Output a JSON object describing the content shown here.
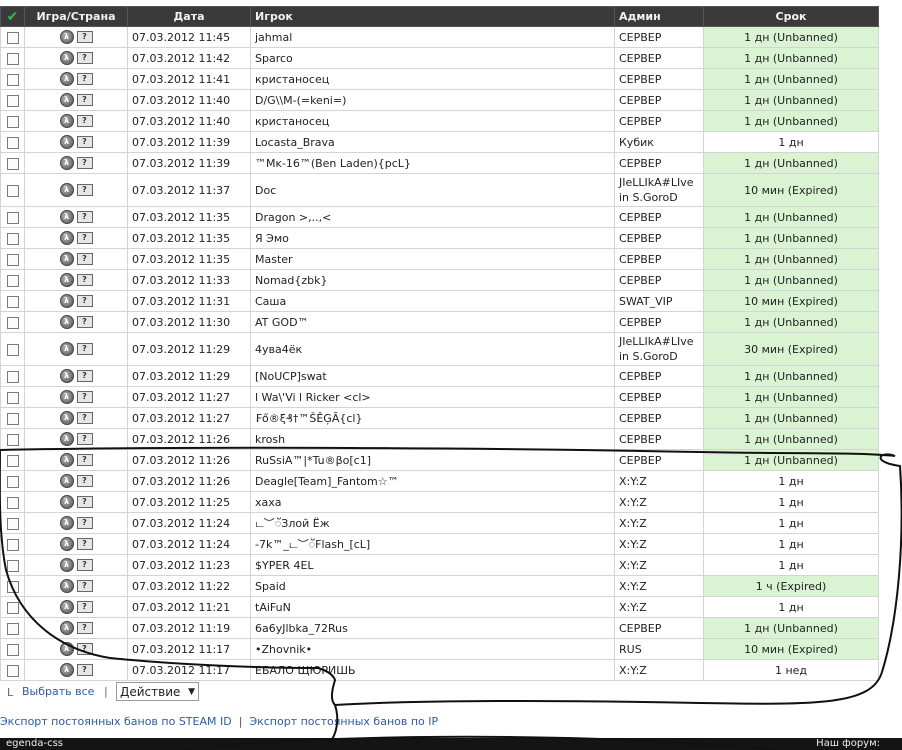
{
  "table": {
    "headers": {
      "check": "✔",
      "game": "Игра/Страна",
      "date": "Дата",
      "player": "Игрок",
      "admin": "Админ",
      "duration": "Срок"
    },
    "rows": [
      {
        "date": "07.03.2012 11:45",
        "player": "jahmal",
        "admin": [
          "СЕРВЕР"
        ],
        "duration": "1 дн (Unbanned)",
        "active": true
      },
      {
        "date": "07.03.2012 11:42",
        "player": "Sparco",
        "admin": [
          "СЕРВЕР"
        ],
        "duration": "1 дн (Unbanned)",
        "active": true
      },
      {
        "date": "07.03.2012 11:41",
        "player": "кристаносец",
        "admin": [
          "СЕРВЕР"
        ],
        "duration": "1 дн (Unbanned)",
        "active": true
      },
      {
        "date": "07.03.2012 11:40",
        "player": "D/G\\\\M-(=keni=)",
        "admin": [
          "СЕРВЕР"
        ],
        "duration": "1 дн (Unbanned)",
        "active": true
      },
      {
        "date": "07.03.2012 11:40",
        "player": "кристаносец",
        "admin": [
          "СЕРВЕР"
        ],
        "duration": "1 дн (Unbanned)",
        "active": true
      },
      {
        "date": "07.03.2012 11:39",
        "player": "Locasta_Brava",
        "admin": [
          "Кубик"
        ],
        "duration": "1 дн",
        "active": false
      },
      {
        "date": "07.03.2012 11:39",
        "player": "™Mĸ-16™(Ben Laden){pcL}",
        "admin": [
          "СЕРВЕР"
        ],
        "duration": "1 дн (Unbanned)",
        "active": true
      },
      {
        "date": "07.03.2012 11:37",
        "player": "Doc",
        "admin": [
          "JIeLLIkA#LIve",
          "in S.GoroD"
        ],
        "duration": "10 мин (Expired)",
        "active": true
      },
      {
        "date": "07.03.2012 11:35",
        "player": "Dragon >,..,<",
        "admin": [
          "СЕРВЕР"
        ],
        "duration": "1 дн (Unbanned)",
        "active": true
      },
      {
        "date": "07.03.2012 11:35",
        "player": "Я Эмо",
        "admin": [
          "СЕРВЕР"
        ],
        "duration": "1 дн (Unbanned)",
        "active": true
      },
      {
        "date": "07.03.2012 11:35",
        "player": "Master",
        "admin": [
          "СЕРВЕР"
        ],
        "duration": "1 дн (Unbanned)",
        "active": true
      },
      {
        "date": "07.03.2012 11:33",
        "player": "Nomad{zbk}",
        "admin": [
          "СЕРВЕР"
        ],
        "duration": "1 дн (Unbanned)",
        "active": true
      },
      {
        "date": "07.03.2012 11:31",
        "player": "Саша",
        "admin": [
          "SWAT_VIP"
        ],
        "duration": "10 мин (Expired)",
        "active": true
      },
      {
        "date": "07.03.2012 11:30",
        "player": "AT GOD™",
        "admin": [
          "СЕРВЕР"
        ],
        "duration": "1 дн (Unbanned)",
        "active": true
      },
      {
        "date": "07.03.2012 11:29",
        "player": "4ува4ёк",
        "admin": [
          "JIeLLIkA#LIve",
          "in S.GoroD"
        ],
        "duration": "30 мин (Expired)",
        "active": true
      },
      {
        "date": "07.03.2012 11:29",
        "player": "[NoUCP]swat",
        "admin": [
          "СЕРВЕР"
        ],
        "duration": "1 дн (Unbanned)",
        "active": true
      },
      {
        "date": "07.03.2012 11:27",
        "player": "l Wa\\'Vi l Ricker <cl>",
        "admin": [
          "СЕРВЕР"
        ],
        "duration": "1 дн (Unbanned)",
        "active": true
      },
      {
        "date": "07.03.2012 11:27",
        "player": "₣ő®ξ₰†™ŠĚĢÃ{cl}",
        "admin": [
          "СЕРВЕР"
        ],
        "duration": "1 дн (Unbanned)",
        "active": true
      },
      {
        "date": "07.03.2012 11:26",
        "player": "krosh",
        "admin": [
          "СЕРВЕР"
        ],
        "duration": "1 дн (Unbanned)",
        "active": true
      },
      {
        "date": "07.03.2012 11:26",
        "player": "RuSsiA™|*Tu®βo[c1]",
        "admin": [
          "СЕРВЕР"
        ],
        "duration": "1 дн (Unbanned)",
        "active": true
      },
      {
        "date": "07.03.2012 11:26",
        "player": "Deagle[Team]_Fantom☆™",
        "admin": [
          "X:Y:Z"
        ],
        "duration": "1 дн",
        "active": false
      },
      {
        "date": "07.03.2012 11:25",
        "player": "хаха",
        "admin": [
          "X:Y:Z"
        ],
        "duration": "1 дн",
        "active": false
      },
      {
        "date": "07.03.2012 11:24",
        "player": "ட︶ॅЗлой Ёж",
        "admin": [
          "X:Y:Z"
        ],
        "duration": "1 дн",
        "active": false
      },
      {
        "date": "07.03.2012 11:24",
        "player": "-7k™_ட︶ॅFlash_[cL]",
        "admin": [
          "X:Y:Z"
        ],
        "duration": "1 дн",
        "active": false
      },
      {
        "date": "07.03.2012 11:23",
        "player": "$YPER 4EL",
        "admin": [
          "X:Y:Z"
        ],
        "duration": "1 дн",
        "active": false
      },
      {
        "date": "07.03.2012 11:22",
        "player": "Spaid",
        "admin": [
          "X:Y:Z"
        ],
        "duration": "1 ч (Expired)",
        "active": true
      },
      {
        "date": "07.03.2012 11:21",
        "player": "tAiFuN",
        "admin": [
          "X:Y:Z"
        ],
        "duration": "1 дн",
        "active": false
      },
      {
        "date": "07.03.2012 11:19",
        "player": "6a6yJlbka_72Rus",
        "admin": [
          "СЕРВЕР"
        ],
        "duration": "1 дн (Unbanned)",
        "active": true
      },
      {
        "date": "07.03.2012 11:17",
        "player": "•Zhovnik•",
        "admin": [
          "RUS"
        ],
        "duration": "10 мин (Expired)",
        "active": true
      },
      {
        "date": "07.03.2012 11:17",
        "player": "ЕБАЛО ЩЮРИШЬ",
        "admin": [
          "X:Y:Z"
        ],
        "duration": "1 нед",
        "active": false
      }
    ]
  },
  "footer": {
    "arrow": "L",
    "select_all": "Выбрать все",
    "separator": "|",
    "action_label": "Действие",
    "action_caret": "▼"
  },
  "export": {
    "steam_link": "Экспорт постоянных банов по STEAM ID",
    "separator": "|",
    "ip_link": "Экспорт постоянных банов по IP"
  },
  "bottom_bar": {
    "left": "egenda-css",
    "right": "Наш форум:"
  },
  "icons": {
    "game": "hl-game-icon",
    "flag": "unknown-flag-icon",
    "game_glyph": "λ",
    "flag_glyph": "?"
  },
  "colors": {
    "header_bg": "#3a3a3a",
    "active_duration_bg": "#d9f3d3",
    "link": "#2d5aa6"
  }
}
